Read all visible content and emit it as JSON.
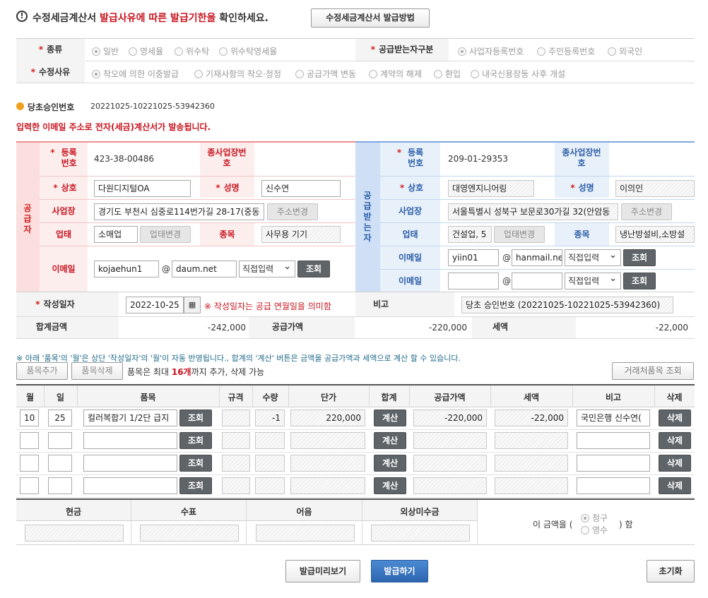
{
  "notice": {
    "pre": "수정세금계산서",
    "mid": "발급사유에 따른 발급기한을",
    "post": "확인하세요.",
    "button": "수정세금계산서 발급방법"
  },
  "type_row": {
    "label": "종류",
    "options": [
      "일반",
      "영세율",
      "위수탁",
      "위수탁영세율"
    ],
    "selected": 0
  },
  "recv_type": {
    "label": "공급받는자구분",
    "options": [
      "사업자등록번호",
      "주민등록번호",
      "외국인"
    ],
    "selected": 0
  },
  "reason": {
    "label": "수정사유",
    "options": [
      "착오에 의한 이중발급",
      "기재사항의 착오·정정",
      "공급가액 변동",
      "계약의 해제",
      "환입",
      "내국신용장등 사후 개설"
    ],
    "selected": 0
  },
  "approval": {
    "label": "당초승인번호",
    "value": "20221025-10221025-53942360"
  },
  "email_notice": "입력한 이메일 주소로 전자(세금)계산서가 발송됩니다.",
  "supplier": {
    "side_label": "공급자",
    "reg_label": "등록번호",
    "reg_no": "423-38-00486",
    "sub_label": "종사업장번호",
    "name_label": "상호",
    "name": "다원디지털OA",
    "rep_label": "성명",
    "rep": "신수연",
    "addr_label": "사업장",
    "addr": "경기도 부천시 심중로114번가길 28-17(중동",
    "addr_btn": "주소변경",
    "biz_label": "업태",
    "biz": "소매업",
    "biz_btn": "업태변경",
    "item_label": "종목",
    "item": "사무용 기기",
    "email_label": "이메일",
    "email_id": "kojaehun1",
    "email_domain": "daum.net",
    "email_sel": "직접입력",
    "lookup": "조회"
  },
  "receiver": {
    "side_label": "공급받는자",
    "reg_label": "등록번호",
    "reg_no": "209-01-29353",
    "sub_label": "종사업장번호",
    "name_label": "상호",
    "name": "대영엔지니어링",
    "rep_label": "성명",
    "rep": "이의인",
    "addr_label": "사업장",
    "addr": "서울특별시 성북구 보문로30가길 32(안암동",
    "addr_btn": "주소변경",
    "biz_label": "업태",
    "biz": "건설업, 5",
    "biz_btn": "업태변경",
    "item_label": "종목",
    "item": "냉난방설비,소방설",
    "email_label": "이메일",
    "email_id": "yiin01",
    "email_domain": "hanmail.ne",
    "email_sel": "직접입력",
    "lookup": "조회",
    "email2_label": "이메일",
    "email2_sel": "직접입력",
    "lookup2": "조회"
  },
  "date": {
    "label": "작성일자",
    "value": "2022-10-25",
    "note": "※ 작성일자는 공급 연월일을 의미함",
    "remark_label": "비고",
    "remark": "당초 승인번호 (20221025-10221025-53942360)"
  },
  "totals": {
    "total_label": "합계금액",
    "total": "-242,000",
    "supply_label": "공급가액",
    "supply": "-220,000",
    "tax_label": "세액",
    "tax": "-22,000"
  },
  "items_note": "※ 아래 '품목'의 '월'은 상단 '작성일자'의 '월'이 자동 반영됩니다., 합계의 '계산' 버튼은 금액을 공급가액과 세액으로 계산 할 수 있습니다.",
  "items_toolbar": {
    "add": "품목추가",
    "del": "품목삭제",
    "info_pre": "품목은 최대",
    "info_bold": "16개",
    "info_post": "까지 추가, 삭제 가능",
    "partner_btn": "거래처품목 조회"
  },
  "items_headers": [
    "월",
    "일",
    "품목",
    "규격",
    "수량",
    "단가",
    "합계",
    "공급가액",
    "세액",
    "비고",
    "삭제"
  ],
  "items": [
    {
      "month": "10",
      "day": "25",
      "name": "컬러복합기 1/2단 급지",
      "spec": "",
      "qty": "-1",
      "price": "220,000",
      "supply": "-220,000",
      "tax": "-22,000",
      "remark": "국민은행 신수연("
    },
    {
      "month": "",
      "day": "",
      "name": "",
      "spec": "",
      "qty": "",
      "price": "",
      "supply": "",
      "tax": "",
      "remark": ""
    },
    {
      "month": "",
      "day": "",
      "name": "",
      "spec": "",
      "qty": "",
      "price": "",
      "supply": "",
      "tax": "",
      "remark": ""
    },
    {
      "month": "",
      "day": "",
      "name": "",
      "spec": "",
      "qty": "",
      "price": "",
      "supply": "",
      "tax": "",
      "remark": ""
    }
  ],
  "row_buttons": {
    "lookup": "조회",
    "calc": "계산",
    "del": "삭제"
  },
  "payment": {
    "headers": [
      "현금",
      "수표",
      "어음",
      "외상미수금"
    ],
    "pre": "이 금액을 (",
    "opts": [
      "청구",
      "영수"
    ],
    "post": ") 함",
    "selected": 0
  },
  "footer": {
    "preview": "발급미리보기",
    "issue": "발급하기",
    "reset": "초기화"
  }
}
